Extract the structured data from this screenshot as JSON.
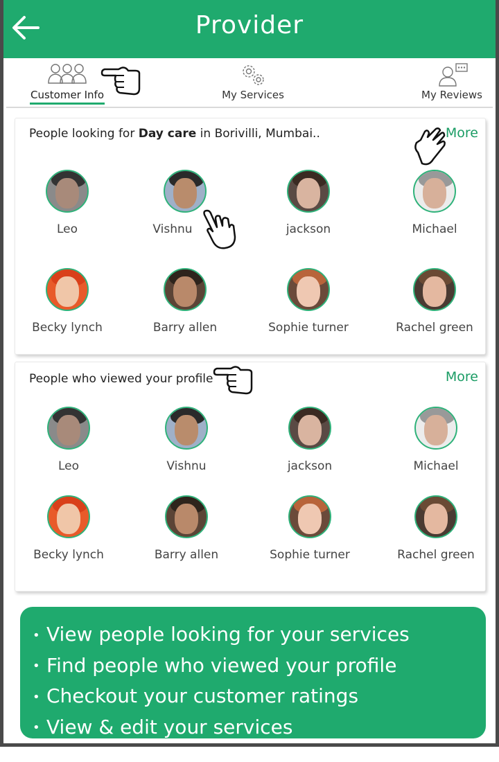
{
  "header": {
    "title": "Provider",
    "back_icon": "arrow-left-icon",
    "color": "#1faa6e"
  },
  "tabs": [
    {
      "label": "Customer Info",
      "icon": "people-group-icon",
      "active": true
    },
    {
      "label": "My Services",
      "icon": "gears-icon",
      "active": false
    },
    {
      "label": "My Reviews",
      "icon": "person-chat-icon",
      "active": false
    }
  ],
  "looking_card": {
    "title_prefix": "People looking for ",
    "title_bold": "Day care",
    "title_suffix": " in Borivilli, Mumbai..",
    "more_label": "More",
    "people": [
      "Leo",
      "Vishnu",
      "jackson",
      "Michael",
      "Becky lynch",
      "Barry allen",
      "Sophie turner",
      "Rachel green"
    ]
  },
  "viewed_card": {
    "title": "People who viewed your profile",
    "more_label": "More",
    "people": [
      "Leo",
      "Vishnu",
      "jackson",
      "Michael",
      "Becky lynch",
      "Barry allen",
      "Sophie turner",
      "Rachel green"
    ]
  },
  "banner": {
    "color": "#1faa6e",
    "bullets": [
      "View people looking for your services",
      "Find people who viewed your profile",
      "Checkout your customer ratings",
      "View & edit your services"
    ]
  }
}
